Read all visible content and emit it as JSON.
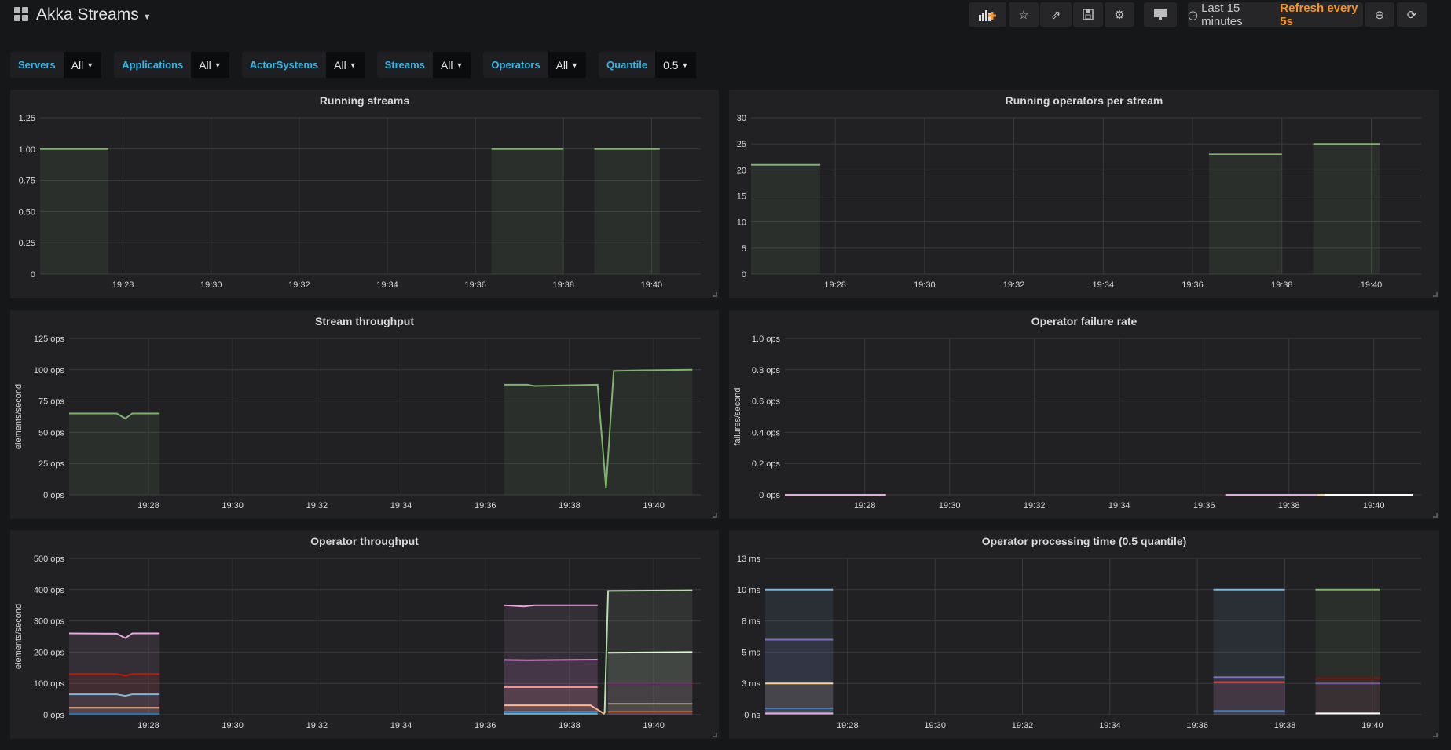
{
  "header": {
    "title": "Akka Streams",
    "time_range": "Last 15 minutes",
    "refresh": "Refresh every 5s",
    "icons": [
      "add-panel-icon",
      "star-icon",
      "share-icon",
      "save-icon",
      "settings-icon",
      "tv-mode-icon",
      "clock-icon",
      "zoom-out-icon",
      "refresh-icon"
    ]
  },
  "variables": [
    {
      "label": "Servers",
      "value": "All"
    },
    {
      "label": "Applications",
      "value": "All"
    },
    {
      "label": "ActorSystems",
      "value": "All"
    },
    {
      "label": "Streams",
      "value": "All"
    },
    {
      "label": "Operators",
      "value": "All"
    },
    {
      "label": "Quantile",
      "value": "0.5"
    }
  ],
  "chart_data": [
    {
      "type": "line",
      "title": "Running streams",
      "ylabel": "",
      "xlim": [
        "19:26:07",
        "19:41:07"
      ],
      "xticks": [
        "19:28",
        "19:30",
        "19:32",
        "19:34",
        "19:36",
        "19:38",
        "19:40"
      ],
      "ylim": [
        0,
        1.25
      ],
      "yticks": [
        {
          "v": 0,
          "label": "0"
        },
        {
          "v": 0.25,
          "label": "0.25"
        },
        {
          "v": 0.5,
          "label": "0.50"
        },
        {
          "v": 0.75,
          "label": "0.75"
        },
        {
          "v": 1,
          "label": "1.00"
        },
        {
          "v": 1.25,
          "label": "1.25"
        }
      ],
      "series": [
        {
          "color": "#7eb26d",
          "points": [
            [
              "19:26:07",
              1
            ],
            [
              "19:27:40",
              1
            ]
          ]
        },
        {
          "color": "#7eb26d",
          "points": [
            [
              "19:36:22",
              1
            ],
            [
              "19:38:00",
              1
            ]
          ]
        },
        {
          "color": "#7eb26d",
          "points": [
            [
              "19:38:42",
              1
            ],
            [
              "19:40:11",
              1
            ]
          ]
        }
      ]
    },
    {
      "type": "line",
      "title": "Running operators per stream",
      "ylabel": "",
      "xlim": [
        "19:26:07",
        "19:41:07"
      ],
      "xticks": [
        "19:28",
        "19:30",
        "19:32",
        "19:34",
        "19:36",
        "19:38",
        "19:40"
      ],
      "ylim": [
        0,
        30
      ],
      "yticks": [
        {
          "v": 0,
          "label": "0"
        },
        {
          "v": 5,
          "label": "5"
        },
        {
          "v": 10,
          "label": "10"
        },
        {
          "v": 15,
          "label": "15"
        },
        {
          "v": 20,
          "label": "20"
        },
        {
          "v": 25,
          "label": "25"
        },
        {
          "v": 30,
          "label": "30"
        }
      ],
      "series": [
        {
          "color": "#7eb26d",
          "points": [
            [
              "19:26:07",
              21
            ],
            [
              "19:27:40",
              21
            ]
          ]
        },
        {
          "color": "#7eb26d",
          "points": [
            [
              "19:36:22",
              23
            ],
            [
              "19:38:00",
              23
            ]
          ]
        },
        {
          "color": "#7eb26d",
          "points": [
            [
              "19:38:42",
              25
            ],
            [
              "19:40:11",
              25
            ]
          ]
        }
      ]
    },
    {
      "type": "line",
      "title": "Stream throughput",
      "ylabel": "elements/second",
      "xlim": [
        "19:26:07",
        "19:41:07"
      ],
      "xticks": [
        "19:28",
        "19:30",
        "19:32",
        "19:34",
        "19:36",
        "19:38",
        "19:40"
      ],
      "ylim": [
        0,
        125
      ],
      "yticks": [
        {
          "v": 0,
          "label": "0 ops"
        },
        {
          "v": 25,
          "label": "25 ops"
        },
        {
          "v": 50,
          "label": "50 ops"
        },
        {
          "v": 75,
          "label": "75 ops"
        },
        {
          "v": 100,
          "label": "100 ops"
        },
        {
          "v": 125,
          "label": "125 ops"
        }
      ],
      "series": [
        {
          "color": "#7eb26d",
          "points": [
            [
              "19:26:07",
              65
            ],
            [
              "19:27:15",
              65
            ],
            [
              "19:27:27",
              61
            ],
            [
              "19:27:37",
              65
            ],
            [
              "19:28:16",
              65
            ]
          ]
        },
        {
          "color": "#7eb26d",
          "points": [
            [
              "19:36:27",
              88
            ],
            [
              "19:37:00",
              88
            ],
            [
              "19:37:10",
              87
            ],
            [
              "19:38:40",
              88
            ],
            [
              "19:38:52",
              5
            ],
            [
              "19:39:03",
              99
            ],
            [
              "19:39:40",
              99.5
            ],
            [
              "19:40:55",
              100
            ]
          ]
        }
      ]
    },
    {
      "type": "line",
      "title": "Operator failure rate",
      "ylabel": "failures/second",
      "xlim": [
        "19:26:07",
        "19:41:07"
      ],
      "xticks": [
        "19:28",
        "19:30",
        "19:32",
        "19:34",
        "19:36",
        "19:38",
        "19:40"
      ],
      "ylim": [
        0,
        1
      ],
      "yticks": [
        {
          "v": 0,
          "label": "0 ops"
        },
        {
          "v": 0.2,
          "label": "0.2 ops"
        },
        {
          "v": 0.4,
          "label": "0.4 ops"
        },
        {
          "v": 0.6,
          "label": "0.6 ops"
        },
        {
          "v": 0.8,
          "label": "0.8 ops"
        },
        {
          "v": 1,
          "label": "1.0 ops"
        }
      ],
      "series": [
        {
          "color": "#e5a8e2",
          "points": [
            [
              "19:26:07",
              0
            ],
            [
              "19:28:30",
              0
            ]
          ]
        },
        {
          "color": "#e5a8e2",
          "points": [
            [
              "19:36:30",
              0
            ],
            [
              "19:38:40",
              0
            ]
          ]
        },
        {
          "color": "#f4d598",
          "points": [
            [
              "19:38:40",
              0
            ],
            [
              "19:38:50",
              0
            ]
          ]
        },
        {
          "color": "#ffffff",
          "points": [
            [
              "19:38:50",
              0
            ],
            [
              "19:40:55",
              0
            ]
          ]
        }
      ]
    },
    {
      "type": "line",
      "title": "Operator throughput",
      "ylabel": "elements/second",
      "xlim": [
        "19:26:07",
        "19:41:07"
      ],
      "xticks": [
        "19:28",
        "19:30",
        "19:32",
        "19:34",
        "19:36",
        "19:38",
        "19:40"
      ],
      "ylim": [
        0,
        500
      ],
      "yticks": [
        {
          "v": 0,
          "label": "0 ops"
        },
        {
          "v": 100,
          "label": "100 ops"
        },
        {
          "v": 200,
          "label": "200 ops"
        },
        {
          "v": 300,
          "label": "300 ops"
        },
        {
          "v": 400,
          "label": "400 ops"
        },
        {
          "v": 500,
          "label": "500 ops"
        }
      ],
      "series": [
        {
          "color": "#e5a8e2",
          "points": [
            [
              "19:26:07",
              260
            ],
            [
              "19:27:15",
              259
            ],
            [
              "19:27:27",
              245
            ],
            [
              "19:27:37",
              260
            ],
            [
              "19:28:16",
              260
            ]
          ]
        },
        {
          "color": "#bf1b00",
          "points": [
            [
              "19:26:07",
              130
            ],
            [
              "19:27:15",
              130
            ],
            [
              "19:27:27",
              125
            ],
            [
              "19:27:37",
              130
            ],
            [
              "19:28:16",
              130
            ]
          ]
        },
        {
          "color": "#82b5d8",
          "points": [
            [
              "19:26:07",
              65
            ],
            [
              "19:27:15",
              65
            ],
            [
              "19:27:27",
              60
            ],
            [
              "19:27:37",
              65
            ],
            [
              "19:28:16",
              65
            ]
          ]
        },
        {
          "color": "#f9ba8f",
          "points": [
            [
              "19:26:07",
              22
            ],
            [
              "19:28:16",
              22
            ]
          ]
        },
        {
          "color": "#1f78c1",
          "points": [
            [
              "19:26:07",
              2
            ],
            [
              "19:28:16",
              2
            ]
          ]
        },
        {
          "color": "#e5a8e2",
          "points": [
            [
              "19:36:27",
              350
            ],
            [
              "19:36:55",
              346
            ],
            [
              "19:37:10",
              350
            ],
            [
              "19:38:40",
              350
            ]
          ]
        },
        {
          "color": "#d683ce",
          "points": [
            [
              "19:36:27",
              175
            ],
            [
              "19:37:00",
              174
            ],
            [
              "19:38:40",
              176
            ]
          ]
        },
        {
          "color": "#f29191",
          "points": [
            [
              "19:36:27",
              88
            ],
            [
              "19:38:40",
              88
            ]
          ]
        },
        {
          "color": "#f9ba8f",
          "points": [
            [
              "19:36:27",
              30
            ],
            [
              "19:38:30",
              30
            ],
            [
              "19:38:50",
              2
            ]
          ]
        },
        {
          "color": "#447ebc",
          "points": [
            [
              "19:36:27",
              10
            ],
            [
              "19:38:40",
              10
            ]
          ]
        },
        {
          "color": "#64b0c8",
          "points": [
            [
              "19:36:27",
              3
            ],
            [
              "19:38:40",
              3
            ]
          ]
        },
        {
          "color": "#b7dbab",
          "points": [
            [
              "19:38:50",
              5
            ],
            [
              "19:38:55",
              396
            ],
            [
              "19:40:55",
              398
            ]
          ]
        },
        {
          "color": "#e0f9d7",
          "points": [
            [
              "19:38:55",
              198
            ],
            [
              "19:40:55",
              200
            ]
          ]
        },
        {
          "color": "#6d1f62",
          "points": [
            [
              "19:38:55",
              97
            ],
            [
              "19:40:55",
              97
            ]
          ]
        },
        {
          "color": "#a0927f",
          "points": [
            [
              "19:38:55",
              35
            ],
            [
              "19:40:55",
              35
            ]
          ]
        },
        {
          "color": "#c15c17",
          "points": [
            [
              "19:38:55",
              10
            ],
            [
              "19:40:55",
              10
            ]
          ]
        },
        {
          "color": "#584477",
          "points": [
            [
              "19:38:55",
              2
            ],
            [
              "19:40:55",
              2
            ]
          ]
        }
      ]
    },
    {
      "type": "line",
      "title": "Operator processing time (0.5 quantile)",
      "ylabel": "",
      "xlim": [
        "19:26:07",
        "19:41:07"
      ],
      "xticks": [
        "19:28",
        "19:30",
        "19:32",
        "19:34",
        "19:36",
        "19:38",
        "19:40"
      ],
      "ylim": [
        0,
        12.5
      ],
      "yticks": [
        {
          "v": 0,
          "label": "0 ns"
        },
        {
          "v": 2.5,
          "label": "3 ms"
        },
        {
          "v": 5,
          "label": "5 ms"
        },
        {
          "v": 7.5,
          "label": "8 ms"
        },
        {
          "v": 10,
          "label": "10 ms"
        },
        {
          "v": 12.5,
          "label": "13 ms"
        }
      ],
      "series": [
        {
          "color": "#82b5d8",
          "points": [
            [
              "19:26:07",
              10
            ],
            [
              "19:27:40",
              10
            ]
          ]
        },
        {
          "color": "#806eb7",
          "points": [
            [
              "19:26:07",
              6
            ],
            [
              "19:27:40",
              6
            ]
          ]
        },
        {
          "color": "#f4d598",
          "points": [
            [
              "19:26:07",
              2.5
            ],
            [
              "19:27:40",
              2.5
            ]
          ]
        },
        {
          "color": "#447ebc",
          "points": [
            [
              "19:26:07",
              0.5
            ],
            [
              "19:27:40",
              0.5
            ]
          ]
        },
        {
          "color": "#e5a8e2",
          "points": [
            [
              "19:26:07",
              0.1
            ],
            [
              "19:27:40",
              0.1
            ]
          ]
        },
        {
          "color": "#82b5d8",
          "points": [
            [
              "19:36:22",
              10
            ],
            [
              "19:38:00",
              10
            ]
          ]
        },
        {
          "color": "#806eb7",
          "points": [
            [
              "19:36:22",
              3
            ],
            [
              "19:38:00",
              3
            ]
          ]
        },
        {
          "color": "#e24d42",
          "points": [
            [
              "19:36:22",
              2.6
            ],
            [
              "19:38:00",
              2.6
            ]
          ]
        },
        {
          "color": "#447ebc",
          "points": [
            [
              "19:36:22",
              0.3
            ],
            [
              "19:38:00",
              0.3
            ]
          ]
        },
        {
          "color": "#7eb26d",
          "points": [
            [
              "19:38:42",
              10
            ],
            [
              "19:40:11",
              10
            ]
          ]
        },
        {
          "color": "#890f02",
          "points": [
            [
              "19:38:42",
              2.9
            ],
            [
              "19:40:11",
              2.9
            ]
          ]
        },
        {
          "color": "#705da0",
          "points": [
            [
              "19:38:42",
              2.5
            ],
            [
              "19:40:11",
              2.5
            ]
          ]
        },
        {
          "color": "#ffffff",
          "points": [
            [
              "19:38:42",
              0.1
            ],
            [
              "19:40:11",
              0.1
            ]
          ]
        }
      ]
    }
  ]
}
